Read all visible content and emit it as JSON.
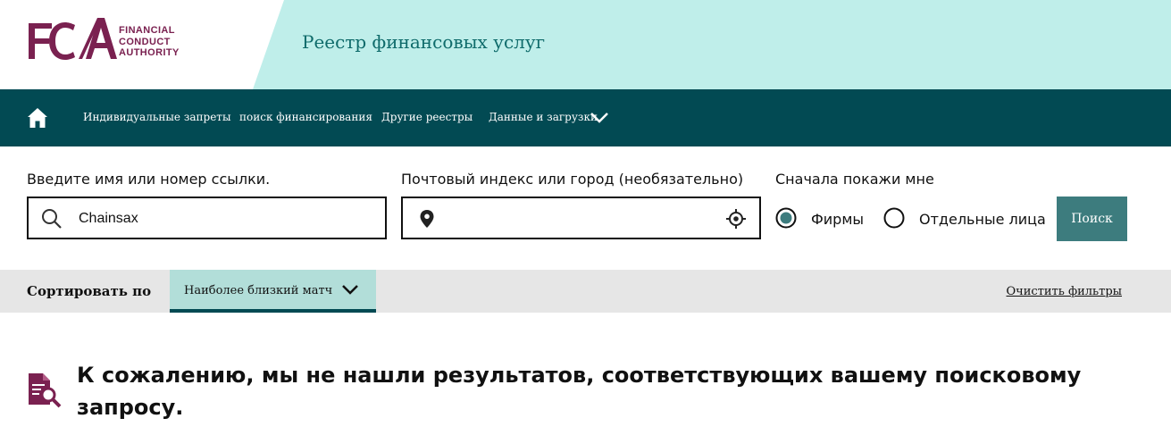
{
  "header": {
    "logo": {
      "letters": "FCA",
      "lines": [
        "FINANCIAL",
        "CONDUCT",
        "AUTHORITY"
      ]
    },
    "site_title": "Реестр финансовых услуг",
    "band_color": "#bfeeea"
  },
  "nav": {
    "home_icon": "home-icon",
    "items": [
      {
        "label": "Индивидуальные запреты"
      },
      {
        "label": "поиск финансирования"
      },
      {
        "label": "Другие реестры"
      },
      {
        "label": "Данные и загрузки"
      }
    ],
    "background": "#024a53"
  },
  "search": {
    "name_label": "Введите имя или номер ссылки.",
    "name_value": "Chainsax",
    "name_icon": "search-icon",
    "postcode_label": "Почтовый индекс или город (необязательно)",
    "postcode_value": "",
    "postcode_icon": "location-pin-icon",
    "locate_icon": "crosshair-icon",
    "show_label": "Сначала покажи мне",
    "options": [
      {
        "label": "Фирмы",
        "selected": true
      },
      {
        "label": "Отдельные лица",
        "selected": false
      }
    ],
    "button_label": "Поиск",
    "button_color": "#3d7c7e"
  },
  "sort": {
    "label": "Сортировать по",
    "selected": "Наиболее близкий матч",
    "clear_label": "Очистить фильтры"
  },
  "results": {
    "icon": "document-search-icon",
    "message": "К сожалению, мы не нашли результатов, соответствующих вашему поисковому запросу."
  }
}
